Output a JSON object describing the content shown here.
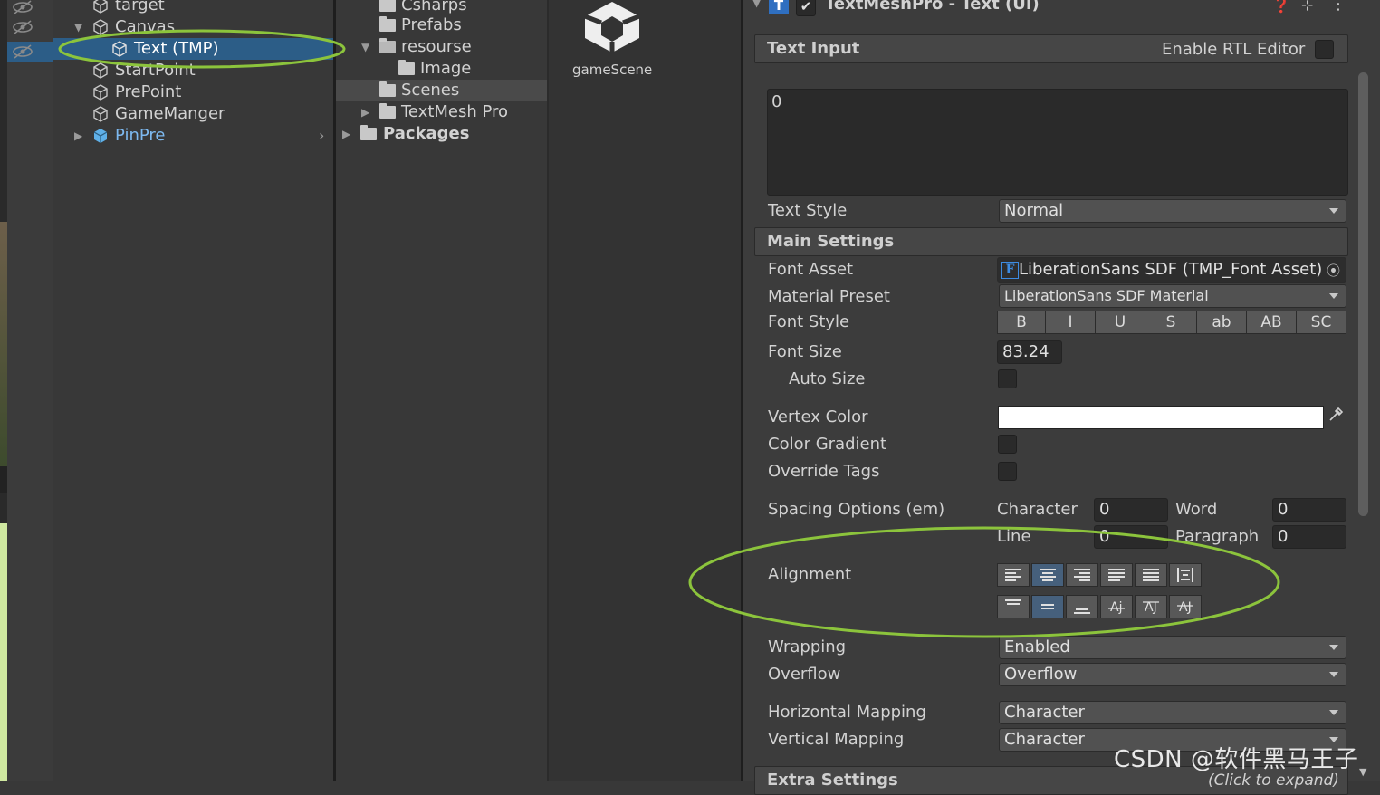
{
  "hierarchy": {
    "items": [
      {
        "label": "target"
      },
      {
        "label": "Canvas"
      },
      {
        "label": "Text (TMP)"
      },
      {
        "label": "StartPoint"
      },
      {
        "label": "PrePoint"
      },
      {
        "label": "GameManger"
      },
      {
        "label": "PinPre"
      }
    ]
  },
  "project": {
    "items": [
      {
        "label": "Csharps"
      },
      {
        "label": "Prefabs"
      },
      {
        "label": "resourse"
      },
      {
        "label": "Image"
      },
      {
        "label": "Scenes"
      },
      {
        "label": "TextMesh Pro"
      },
      {
        "label": "Packages"
      }
    ]
  },
  "assets": {
    "scene_label": "gameScene"
  },
  "inspector": {
    "component_title": "TextMeshPro - Text (UI)",
    "text_input": {
      "header": "Text Input",
      "rtl_label": "Enable RTL Editor",
      "value": "0"
    },
    "text_style": {
      "label": "Text Style",
      "value": "Normal"
    },
    "main_settings": {
      "header": "Main Settings",
      "font_asset_label": "Font Asset",
      "font_asset_value": "LiberationSans SDF (TMP_Font Asset)",
      "material_preset_label": "Material Preset",
      "material_preset_value": "LiberationSans SDF Material",
      "font_style_label": "Font Style",
      "font_style_buttons": [
        "B",
        "I",
        "U",
        "S",
        "ab",
        "AB",
        "SC"
      ],
      "font_size_label": "Font Size",
      "font_size_value": "83.24",
      "auto_size_label": "Auto Size",
      "vertex_color_label": "Vertex Color",
      "color_gradient_label": "Color Gradient",
      "override_tags_label": "Override Tags",
      "spacing_label": "Spacing Options (em)",
      "character_label": "Character",
      "character_value": "0",
      "word_label": "Word",
      "word_value": "0",
      "line_label": "Line",
      "line_value": "0",
      "paragraph_label": "Paragraph",
      "paragraph_value": "0",
      "alignment_label": "Alignment",
      "wrapping_label": "Wrapping",
      "wrapping_value": "Enabled",
      "overflow_label": "Overflow",
      "overflow_value": "Overflow",
      "horizontal_mapping_label": "Horizontal Mapping",
      "horizontal_mapping_value": "Character",
      "vertical_mapping_label": "Vertical Mapping",
      "vertical_mapping_value": "Character"
    },
    "extra_settings": {
      "header": "Extra Settings",
      "hint": "(Click to expand)"
    }
  },
  "annotations": {
    "highlight_color": "#8cc43c"
  },
  "watermark": "CSDN @软件黑马王子"
}
